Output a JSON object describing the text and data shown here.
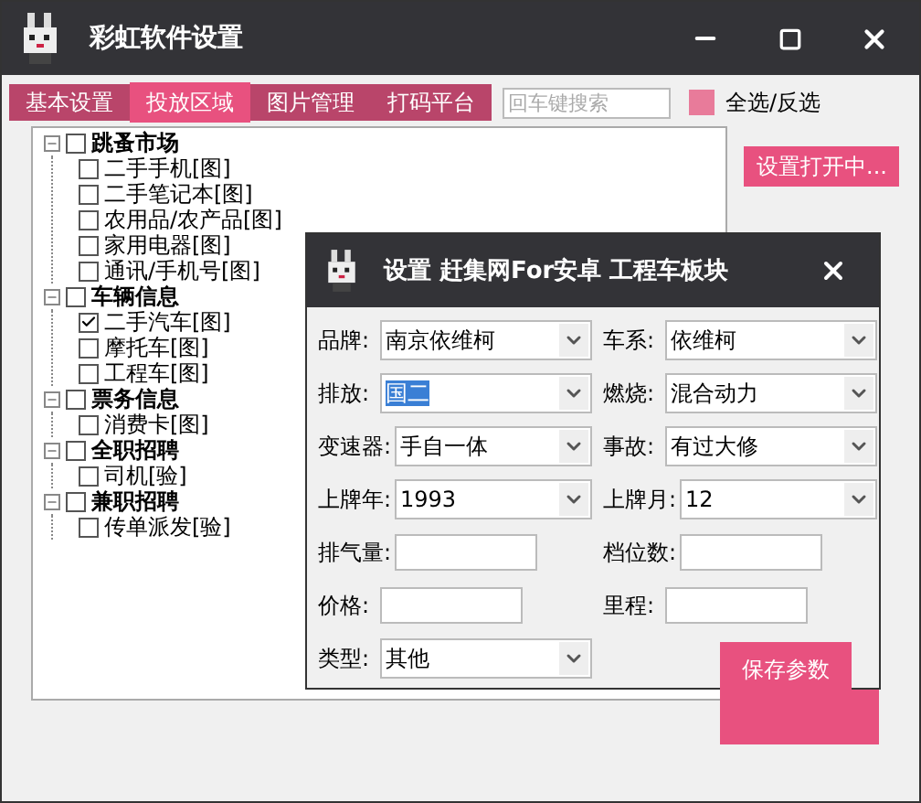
{
  "window": {
    "title": "彩虹软件设置"
  },
  "tabs": [
    {
      "label": "基本设置",
      "selected": false
    },
    {
      "label": "投放区域",
      "selected": true
    },
    {
      "label": "图片管理",
      "selected": false
    },
    {
      "label": "打码平台",
      "selected": false
    }
  ],
  "search": {
    "placeholder": "回车键搜索"
  },
  "select_all": {
    "label": "全选/反选",
    "checked": false
  },
  "open_button": "设置打开中...",
  "tree": [
    {
      "label": "跳蚤市场",
      "checked": false,
      "expanded": true,
      "children": [
        {
          "label": "二手手机[图]",
          "checked": false
        },
        {
          "label": "二手笔记本[图]",
          "checked": false
        },
        {
          "label": "农用品/农产品[图]",
          "checked": false
        },
        {
          "label": "家用电器[图]",
          "checked": false
        },
        {
          "label": "通讯/手机号[图]",
          "checked": false
        }
      ]
    },
    {
      "label": "车辆信息",
      "checked": false,
      "expanded": true,
      "children": [
        {
          "label": "二手汽车[图]",
          "checked": true
        },
        {
          "label": "摩托车[图]",
          "checked": false
        },
        {
          "label": "工程车[图]",
          "checked": false
        }
      ]
    },
    {
      "label": "票务信息",
      "checked": false,
      "expanded": true,
      "children": [
        {
          "label": "消费卡[图]",
          "checked": false
        }
      ]
    },
    {
      "label": "全职招聘",
      "checked": false,
      "expanded": true,
      "children": [
        {
          "label": "司机[验]",
          "checked": false
        }
      ]
    },
    {
      "label": "兼职招聘",
      "checked": false,
      "expanded": true,
      "children": [
        {
          "label": "传单派发[验]",
          "checked": false
        }
      ]
    }
  ],
  "dialog": {
    "title": "设置 赶集网For安卓 工程车板块",
    "fields": [
      {
        "label": "品牌:",
        "kind": "select",
        "value": "南京依维柯",
        "highlighted": false
      },
      {
        "label": "车系:",
        "kind": "select",
        "value": "依维柯",
        "highlighted": false
      },
      {
        "label": "排放:",
        "kind": "select",
        "value": "国二",
        "highlighted": true
      },
      {
        "label": "燃烧:",
        "kind": "select",
        "value": "混合动力",
        "highlighted": false
      },
      {
        "label": "变速器:",
        "kind": "select",
        "value": "手自一体",
        "highlighted": false
      },
      {
        "label": "事故:",
        "kind": "select",
        "value": "有过大修",
        "highlighted": false
      },
      {
        "label": "上牌年:",
        "kind": "select",
        "value": "1993",
        "highlighted": false
      },
      {
        "label": "上牌月:",
        "kind": "select",
        "value": "12",
        "highlighted": false
      },
      {
        "label": "排气量:",
        "kind": "input"
      },
      {
        "label": "档位数:",
        "kind": "input"
      },
      {
        "label": "价格:",
        "kind": "input"
      },
      {
        "label": "里程:",
        "kind": "input"
      },
      {
        "label": "类型:",
        "kind": "select",
        "value": "其他",
        "highlighted": false
      }
    ],
    "save_button": "保存参数"
  }
}
